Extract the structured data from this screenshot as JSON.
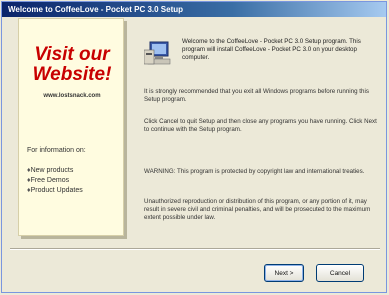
{
  "window": {
    "title": "Welcome to CoffeeLove - Pocket PC 3.0 Setup"
  },
  "sidebar": {
    "headline_line1": "Visit our",
    "headline_line2": "Website!",
    "url": "www.lostsnack.com",
    "info_heading": "For information on:",
    "info_items": [
      "New products",
      "Free Demos",
      "Product Updates"
    ]
  },
  "main": {
    "welcome": "Welcome to the CoffeeLove - Pocket PC 3.0 Setup program. This program will install CoffeeLove - Pocket PC 3.0 on your desktop computer.",
    "para1": "It is strongly recommended that you exit all Windows programs before running this Setup program.",
    "para2": "Click Cancel to quit Setup and then close any programs you have running. Click Next to continue with the Setup program.",
    "para3": "WARNING: This program is protected by copyright law and international treaties.",
    "para4": "Unauthorized reproduction or distribution of this program, or any portion of it, may result in severe civil and criminal penalties, and will be prosecuted to the maximum extent possible under law."
  },
  "buttons": {
    "next_label": "Next >",
    "cancel_label": "Cancel"
  },
  "colors": {
    "headline": "#c80000",
    "sidebar_bg": "#fffce0",
    "titlebar": "#0a246a"
  }
}
